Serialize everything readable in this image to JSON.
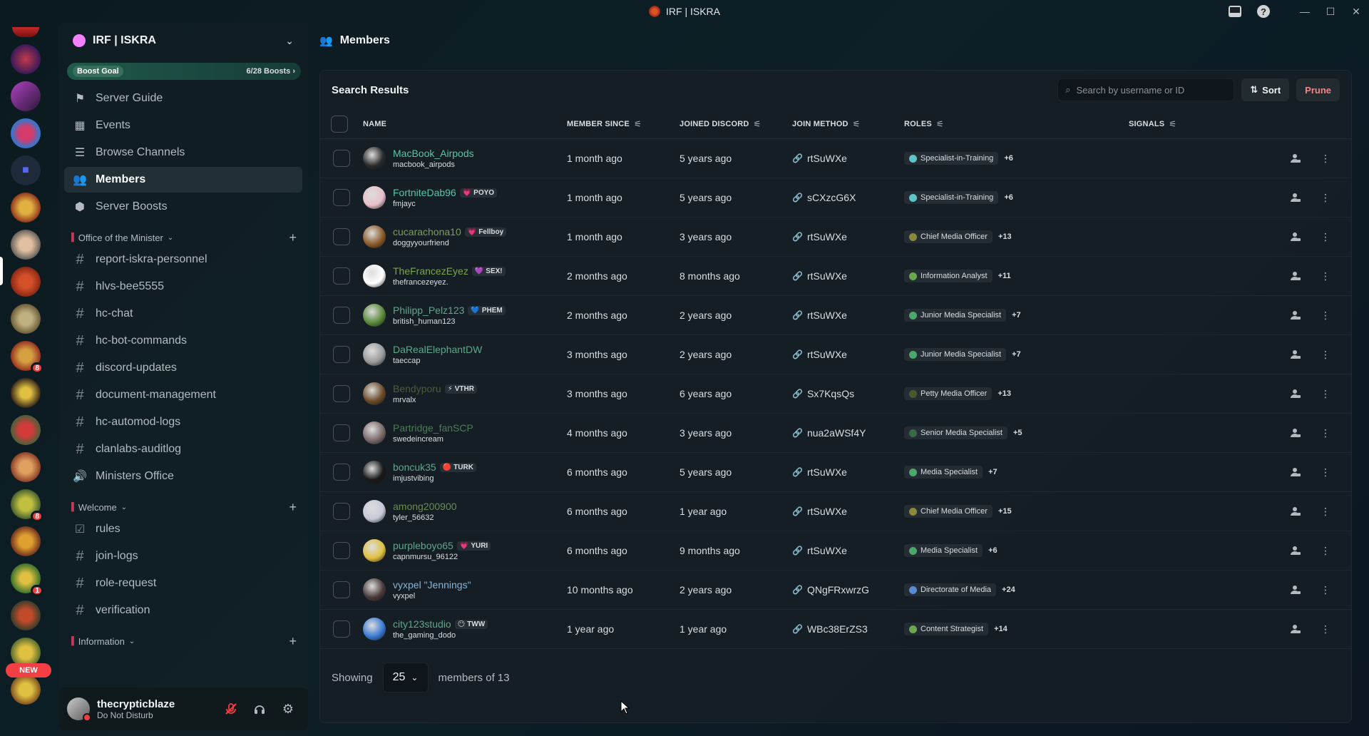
{
  "window": {
    "title": "IRF | ISKRA"
  },
  "guild": {
    "name": "IRF | ISKRA",
    "boost_goal_label": "Boost Goal",
    "boost_count": "6/28 Boosts ›"
  },
  "nav": [
    {
      "label": "Server Guide",
      "icon": "signpost-icon",
      "glyph": "⚑"
    },
    {
      "label": "Events",
      "icon": "calendar-icon",
      "glyph": "▦"
    },
    {
      "label": "Browse Channels",
      "icon": "list-icon",
      "glyph": "☰"
    },
    {
      "label": "Members",
      "icon": "members-icon",
      "glyph": "👥"
    },
    {
      "label": "Server Boosts",
      "icon": "boost-icon",
      "glyph": "⬢"
    }
  ],
  "categories": [
    {
      "label": "Office of the Minister",
      "channels": [
        {
          "label": "report-iskra-personnel",
          "type": "text"
        },
        {
          "label": "hlvs-bee5555",
          "type": "text"
        },
        {
          "label": "hc-chat",
          "type": "text"
        },
        {
          "label": "hc-bot-commands",
          "type": "text"
        },
        {
          "label": "discord-updates",
          "type": "text"
        },
        {
          "label": "document-management",
          "type": "text"
        },
        {
          "label": "hc-automod-logs",
          "type": "text"
        },
        {
          "label": "clanlabs-auditlog",
          "type": "text"
        },
        {
          "label": "Ministers Office",
          "type": "voice"
        }
      ]
    },
    {
      "label": "Welcome",
      "channels": [
        {
          "label": "rules",
          "type": "rules"
        },
        {
          "label": "join-logs",
          "type": "text"
        },
        {
          "label": "role-request",
          "type": "text"
        },
        {
          "label": "verification",
          "type": "text"
        }
      ]
    },
    {
      "label": "Information",
      "channels": []
    }
  ],
  "rail": {
    "badges": [
      "8",
      "8",
      "1"
    ],
    "new_label": "NEW"
  },
  "user": {
    "name": "thecrypticblaze",
    "status": "Do Not Disturb"
  },
  "main": {
    "header": "Members",
    "panel_title": "Search Results",
    "search_placeholder": "Search by username or ID",
    "sort_label": "Sort",
    "prune_label": "Prune",
    "columns": {
      "name": "NAME",
      "since": "MEMBER SINCE",
      "joined": "JOINED DISCORD",
      "method": "JOIN METHOD",
      "roles": "ROLES",
      "signals": "SIGNALS"
    },
    "members": [
      {
        "display": "MacBook_Airpods",
        "user": "macbook_airpods",
        "tag": "",
        "tag_icon": "",
        "color": "#5ec4a8",
        "since": "1 month ago",
        "joined": "5 years ago",
        "invite": "rtSuWXe",
        "role": "Specialist-in-Training",
        "role_color": "#5ec4c8",
        "more": "+6",
        "av": "#2a2a2a"
      },
      {
        "display": "FortniteDab96",
        "user": "fmjayc",
        "tag": "POYO",
        "tag_icon": "💗",
        "color": "#5ec4a8",
        "since": "1 month ago",
        "joined": "5 years ago",
        "invite": "sCXzcG6X",
        "role": "Specialist-in-Training",
        "role_color": "#5ec4c8",
        "more": "+6",
        "av": "#e7c1c9"
      },
      {
        "display": "cucarachona10",
        "user": "doggyyourfriend",
        "tag": "Fellboy",
        "tag_icon": "💗",
        "color": "#7a9e5a",
        "since": "1 month ago",
        "joined": "3 years ago",
        "invite": "rtSuWXe",
        "role": "Chief Media Officer",
        "role_color": "#8a8a3a",
        "more": "+13",
        "av": "#8a5a2a"
      },
      {
        "display": "TheFrancezEyez",
        "user": "thefrancezeyez.",
        "tag": "SEX!",
        "tag_icon": "💜",
        "color": "#7aa64a",
        "since": "2 months ago",
        "joined": "8 months ago",
        "invite": "rtSuWXe",
        "role": "Information Analyst",
        "role_color": "#6aa84f",
        "more": "+11",
        "av": "#ffffff"
      },
      {
        "display": "Philipp_Pelz123",
        "user": "british_human123",
        "tag": "PHEM",
        "tag_icon": "💙",
        "color": "#5ea88a",
        "since": "2 months ago",
        "joined": "2 years ago",
        "invite": "rtSuWXe",
        "role": "Junior Media Specialist",
        "role_color": "#4aa86a",
        "more": "+7",
        "av": "#5a8a3a"
      },
      {
        "display": "DaRealElephantDW",
        "user": "taeccap",
        "tag": "",
        "tag_icon": "",
        "color": "#5ea88a",
        "since": "3 months ago",
        "joined": "2 years ago",
        "invite": "rtSuWXe",
        "role": "Junior Media Specialist",
        "role_color": "#4aa86a",
        "more": "+7",
        "av": "#9a9a9a"
      },
      {
        "display": "Bendyporu",
        "user": "mrvalx",
        "tag": "VTHR",
        "tag_icon": "⚡",
        "color": "#4e5a3a",
        "since": "3 months ago",
        "joined": "6 years ago",
        "invite": "Sx7KqsQs",
        "role": "Petty Media Officer",
        "role_color": "#4a5a2a",
        "more": "+13",
        "av": "#6a4a2a"
      },
      {
        "display": "Partridge_fanSCP",
        "user": "swedeincream",
        "tag": "",
        "tag_icon": "",
        "color": "#4e7a5a",
        "since": "4 months ago",
        "joined": "3 years ago",
        "invite": "nua2aWSf4Y",
        "role": "Senior Media Specialist",
        "role_color": "#3a6a4a",
        "more": "+5",
        "av": "#7a6a6a"
      },
      {
        "display": "boncuk35",
        "user": "imjustvibing",
        "tag": "TURK",
        "tag_icon": "🔴",
        "color": "#5ea88a",
        "since": "6 months ago",
        "joined": "5 years ago",
        "invite": "rtSuWXe",
        "role": "Media Specialist",
        "role_color": "#4aa86a",
        "more": "+7",
        "av": "#1a1a1a"
      },
      {
        "display": "among200900",
        "user": "tyler_56632",
        "tag": "",
        "tag_icon": "",
        "color": "#6a8a5a",
        "since": "6 months ago",
        "joined": "1 year ago",
        "invite": "rtSuWXe",
        "role": "Chief Media Officer",
        "role_color": "#8a8a3a",
        "more": "+15",
        "av": "#c8c8d8"
      },
      {
        "display": "purpleboyo65",
        "user": "capnmursu_96122",
        "tag": "YURI",
        "tag_icon": "💗",
        "color": "#5ea88a",
        "since": "6 months ago",
        "joined": "9 months ago",
        "invite": "rtSuWXe",
        "role": "Media Specialist",
        "role_color": "#4aa86a",
        "more": "+6",
        "av": "#e0c040"
      },
      {
        "display": "vyxpel \"Jennings\"",
        "user": "vyxpel",
        "tag": "",
        "tag_icon": "",
        "color": "#8ab4d4",
        "since": "10 months ago",
        "joined": "2 years ago",
        "invite": "QNgFRxwrzG",
        "role": "Directorate of Media",
        "role_color": "#5a8ad4",
        "more": "+24",
        "av": "#4a3a3a"
      },
      {
        "display": "city123studio",
        "user": "the_gaming_dodo",
        "tag": "TWW",
        "tag_icon": "😶",
        "color": "#5ea88a",
        "since": "1 year ago",
        "joined": "1 year ago",
        "invite": "WBc38ErZS3",
        "role": "Content Strategist",
        "role_color": "#6aa84f",
        "more": "+14",
        "av": "#3a7ad4"
      }
    ],
    "footer": {
      "showing_label": "Showing",
      "page_size": "25",
      "suffix": "members of 13"
    }
  }
}
